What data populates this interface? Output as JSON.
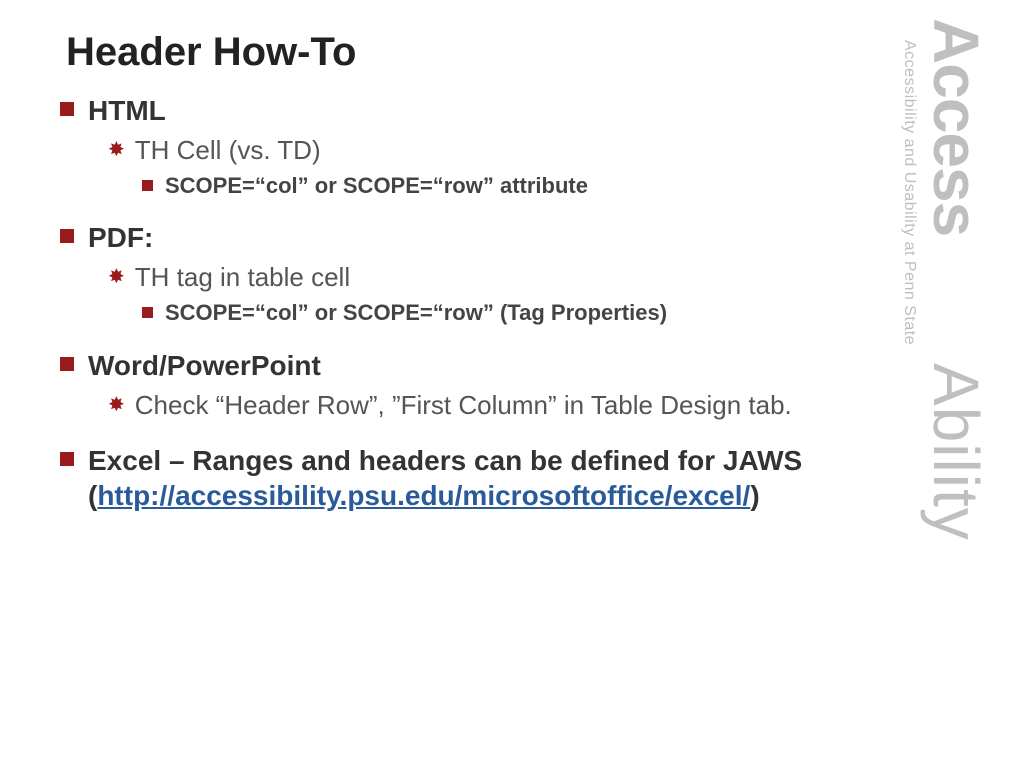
{
  "title": "Header How-To",
  "items": [
    {
      "label": "HTML",
      "subs": [
        {
          "label": "TH Cell (vs. TD)",
          "details": [
            "SCOPE=“col” or SCOPE=“row” attribute"
          ]
        }
      ]
    },
    {
      "label": "PDF:",
      "subs": [
        {
          "label": "TH tag in table cell",
          "details": [
            "SCOPE=“col” or SCOPE=“row” (Tag Properties)"
          ]
        }
      ]
    },
    {
      "label": "Word/PowerPoint",
      "subs": [
        {
          "label": "Check “Header Row”, ”First Column” in Table Design tab.",
          "details": []
        }
      ]
    },
    {
      "label_prefix": "Excel – Ranges and headers can be defined for JAWS",
      "link_open": "(",
      "link_text": "http://accessibility.psu.edu/microsoftoffice/excel/",
      "link_close": ")",
      "subs": []
    }
  ],
  "brand": {
    "word1": "Access",
    "word2": "Ability",
    "tagline": "Accessibility and Usability at Penn State"
  }
}
